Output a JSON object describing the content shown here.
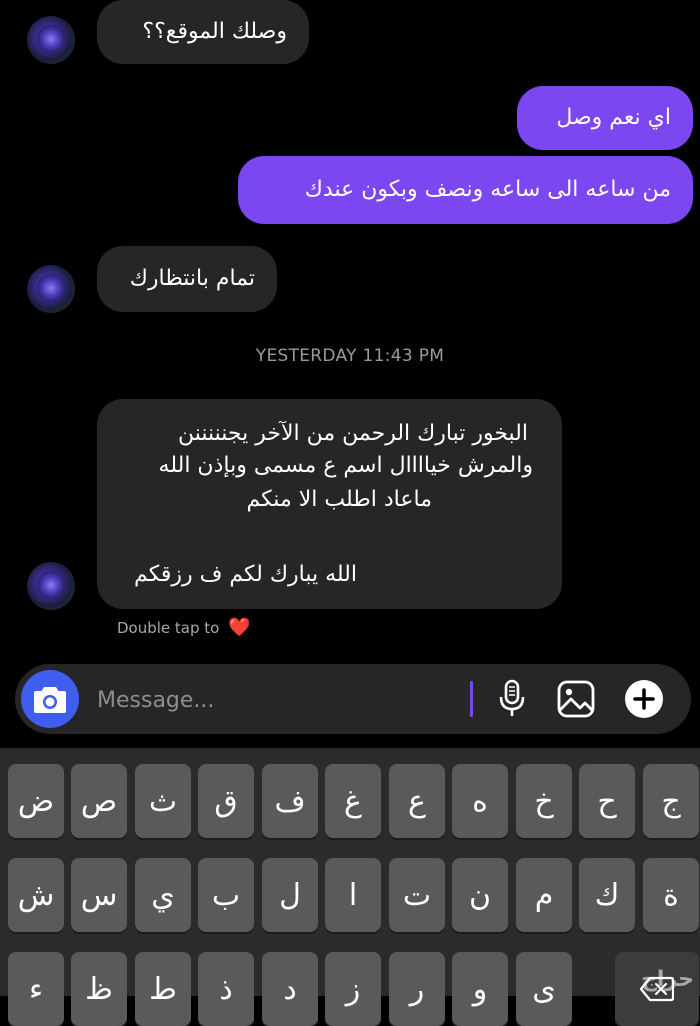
{
  "messages": [
    {
      "text": "وصلك الموقع؟؟"
    },
    {
      "text": "اي نعم وصل"
    },
    {
      "text": "من ساعه الى ساعه ونصف وبكون عندك"
    },
    {
      "text": "تمام بانتظارك"
    },
    {
      "lines": [
        "البخور تبارك الرحمن من الآخر يجنننننن",
        "والمرش خياااال اسم ع مسمى وبإذن الله",
        "ماعاد اطلب الا منكم",
        "",
        "الله يبارك لكم ف رزقكم"
      ]
    }
  ],
  "timestamp": "YESTERDAY 11:43 PM",
  "reaction_hint": {
    "text": "Double tap to",
    "emoji": "❤️"
  },
  "composer": {
    "placeholder": "Message..."
  },
  "keyboard": {
    "row1": [
      "ض",
      "ص",
      "ث",
      "ق",
      "ف",
      "غ",
      "ع",
      "ه",
      "خ",
      "ح",
      "ج"
    ],
    "row2": [
      "ش",
      "س",
      "ي",
      "ب",
      "ل",
      "ا",
      "ت",
      "ن",
      "م",
      "ك",
      "ة"
    ],
    "row3": [
      "ء",
      "ظ",
      "ط",
      "ذ",
      "د",
      "ز",
      "ر",
      "و",
      "ى"
    ]
  },
  "watermark": "حراج",
  "colors": {
    "outgoing": "#7c46f0",
    "incoming": "#262626",
    "camera": "#3f5ef0",
    "heart": "#ff3040"
  }
}
